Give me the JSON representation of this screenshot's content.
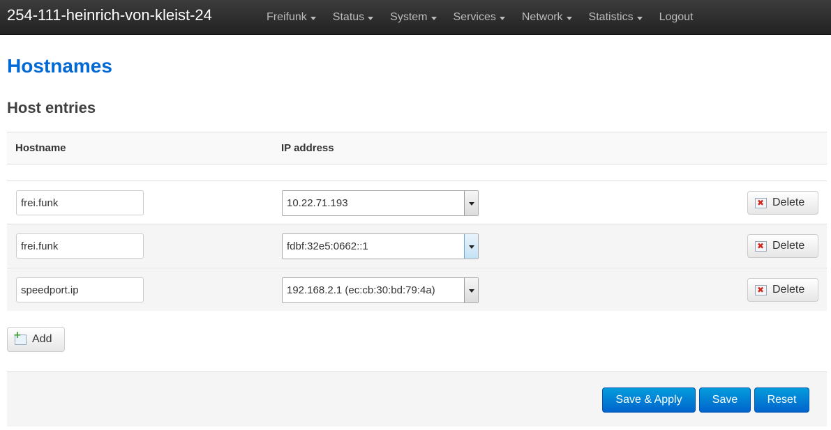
{
  "header": {
    "brand": "254-111-heinrich-von-kleist-24",
    "nav": [
      {
        "label": "Freifunk",
        "dropdown": true
      },
      {
        "label": "Status",
        "dropdown": true
      },
      {
        "label": "System",
        "dropdown": true
      },
      {
        "label": "Services",
        "dropdown": true
      },
      {
        "label": "Network",
        "dropdown": true
      },
      {
        "label": "Statistics",
        "dropdown": true
      },
      {
        "label": "Logout",
        "dropdown": false
      }
    ]
  },
  "page": {
    "title": "Hostnames",
    "section_title": "Host entries"
  },
  "table": {
    "columns": [
      "Hostname",
      "IP address"
    ],
    "rows": [
      {
        "hostname": "frei.funk",
        "ip": "10.22.71.193",
        "delete_label": "Delete"
      },
      {
        "hostname": "frei.funk",
        "ip": "fdbf:32e5:0662::1",
        "delete_label": "Delete"
      },
      {
        "hostname": "speedport.ip",
        "ip": "192.168.2.1 (ec:cb:30:bd:79:4a)",
        "delete_label": "Delete"
      }
    ]
  },
  "actions": {
    "add_label": "Add",
    "save_apply_label": "Save & Apply",
    "save_label": "Save",
    "reset_label": "Reset"
  },
  "colors": {
    "accent": "#0069d6",
    "primary_button": "#0064cd",
    "topbar": "#222222"
  },
  "icons": {
    "delete": "delete-icon",
    "add": "add-icon",
    "dropdown": "chevron-down-icon"
  }
}
